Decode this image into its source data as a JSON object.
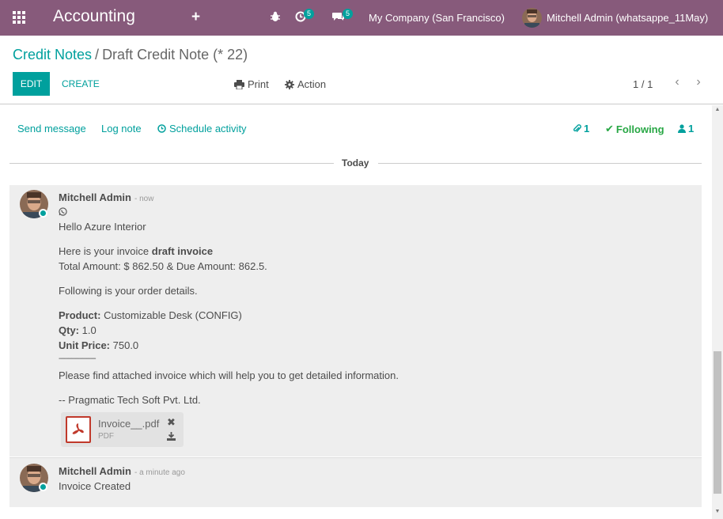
{
  "navbar": {
    "app_title": "Accounting",
    "activity_count": "5",
    "messages_count": "5",
    "company": "My Company (San Francisco)",
    "user": "Mitchell Admin (whatsappe_11May)"
  },
  "breadcrumb": {
    "parent": "Credit Notes",
    "separator": "/",
    "current": "Draft Credit Note (* 22)"
  },
  "toolbar": {
    "edit_label": "EDIT",
    "create_label": "CREATE",
    "print_label": "Print",
    "action_label": "Action",
    "pager": "1 / 1"
  },
  "chatter": {
    "send_message": "Send message",
    "log_note": "Log note",
    "schedule_activity": "Schedule activity",
    "attachment_count": "1",
    "following_label": "Following",
    "follower_count": "1",
    "date_separator": "Today"
  },
  "messages": [
    {
      "author": "Mitchell Admin",
      "date": "- now",
      "lines": {
        "greeting": "Hello Azure Interior",
        "invoice_prefix": "Here is your invoice ",
        "invoice_bold": "draft invoice",
        "total": "Total Amount: $ 862.50 & Due Amount: 862.5.",
        "following": "Following is your order details.",
        "product_label": "Product:",
        "product_value": " Customizable Desk (CONFIG)",
        "qty_label": "Qty:",
        "qty_value": " 1.0",
        "price_label": "Unit Price:",
        "price_value": " 750.0",
        "rule": "--------------------",
        "attached": "Please find attached invoice which will help you to get detailed information.",
        "signature": "-- Pragmatic Tech Soft Pvt. Ltd."
      },
      "attachment": {
        "name": "Invoice__.pdf",
        "type": "PDF"
      }
    },
    {
      "author": "Mitchell Admin",
      "date": "- a minute ago",
      "body": "Invoice Created"
    }
  ],
  "colors": {
    "navbar": "#875a7b",
    "accent": "#00a09d",
    "following": "#28a745"
  }
}
